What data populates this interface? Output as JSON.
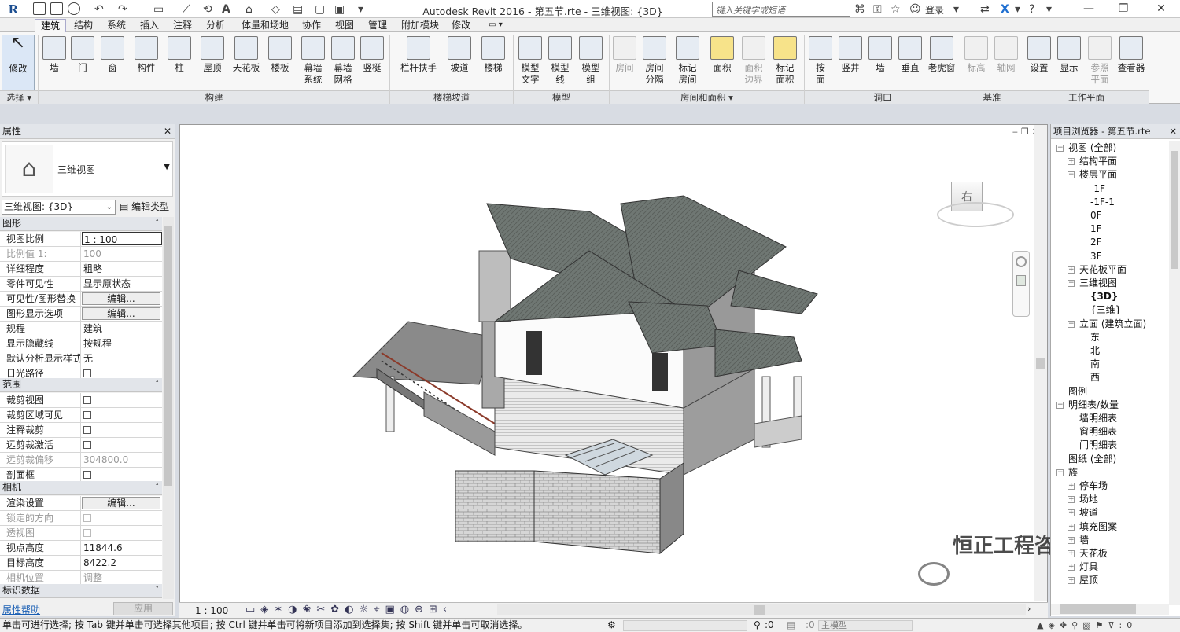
{
  "app": {
    "logo": "R",
    "title": "Autodesk Revit 2016 -    第五节.rte - 三维视图: {3D}",
    "search_placeholder": "键入关键字或短语",
    "login": "登录"
  },
  "tabs": [
    "建筑",
    "结构",
    "系统",
    "插入",
    "注释",
    "分析",
    "体量和场地",
    "协作",
    "视图",
    "管理",
    "附加模块",
    "修改"
  ],
  "ribbon": {
    "buttons": [
      {
        "label": "修改"
      },
      {
        "label": "墙"
      },
      {
        "label": "门"
      },
      {
        "label": "窗"
      },
      {
        "label": "构件"
      },
      {
        "label": "柱"
      },
      {
        "label": "屋顶"
      },
      {
        "label": "天花板"
      },
      {
        "label": "楼板"
      },
      {
        "label": "幕墙\n系统"
      },
      {
        "label": "幕墙\n网格"
      },
      {
        "label": "竖梃"
      },
      {
        "label": "栏杆扶手"
      },
      {
        "label": "坡道"
      },
      {
        "label": "楼梯"
      },
      {
        "label": "模型\n文字"
      },
      {
        "label": "模型\n线"
      },
      {
        "label": "模型\n组"
      },
      {
        "label": "房间"
      },
      {
        "label": "房间\n分隔"
      },
      {
        "label": "标记\n房间"
      },
      {
        "label": "面积"
      },
      {
        "label": "面积\n边界"
      },
      {
        "label": "标记\n面积"
      },
      {
        "label": "按\n面"
      },
      {
        "label": "竖井"
      },
      {
        "label": "墙"
      },
      {
        "label": "垂直"
      },
      {
        "label": "老虎窗"
      },
      {
        "label": "标高"
      },
      {
        "label": "轴网"
      },
      {
        "label": "设置"
      },
      {
        "label": "显示"
      },
      {
        "label": "参照\n平面"
      },
      {
        "label": "查看器"
      }
    ],
    "panels": [
      "选择",
      "构建",
      "楼梯坡道",
      "模型",
      "房间和面积",
      "洞口",
      "基准",
      "工作平面"
    ]
  },
  "properties": {
    "title": "属性",
    "type_name": "三维视图",
    "instance_selector": "三维视图: {3D}",
    "edit_type": "编辑类型",
    "sections": {
      "graphics": "图形",
      "extents": "范围",
      "camera": "相机",
      "identity": "标识数据"
    },
    "rows_graphics": [
      {
        "k": "视图比例",
        "v": "1 : 100"
      },
      {
        "k": "比例值 1:",
        "v": "100"
      },
      {
        "k": "详细程度",
        "v": "粗略"
      },
      {
        "k": "零件可见性",
        "v": "显示原状态"
      },
      {
        "k": "可见性/图形替换",
        "v": "编辑..."
      },
      {
        "k": "图形显示选项",
        "v": "编辑..."
      },
      {
        "k": "规程",
        "v": "建筑"
      },
      {
        "k": "显示隐藏线",
        "v": "按规程"
      },
      {
        "k": "默认分析显示样式",
        "v": "无"
      },
      {
        "k": "日光路径",
        "v": ""
      }
    ],
    "rows_extents": [
      {
        "k": "裁剪视图",
        "v": ""
      },
      {
        "k": "裁剪区域可见",
        "v": ""
      },
      {
        "k": "注释裁剪",
        "v": ""
      },
      {
        "k": "远剪裁激活",
        "v": ""
      },
      {
        "k": "远剪裁偏移",
        "v": "304800.0"
      },
      {
        "k": "剖面框",
        "v": ""
      }
    ],
    "rows_camera": [
      {
        "k": "渲染设置",
        "v": "编辑..."
      },
      {
        "k": "锁定的方向",
        "v": ""
      },
      {
        "k": "透视图",
        "v": ""
      },
      {
        "k": "视点高度",
        "v": "11844.6"
      },
      {
        "k": "目标高度",
        "v": "8422.2"
      },
      {
        "k": "相机位置",
        "v": "调整"
      }
    ],
    "help": "属性帮助",
    "apply": "应用"
  },
  "viewcube": {
    "face": "右"
  },
  "browser": {
    "title": "项目浏览器 - 第五节.rte",
    "nodes": [
      {
        "t": "视图 (全部)",
        "d": 0
      },
      {
        "t": "结构平面",
        "d": 1
      },
      {
        "t": "楼层平面",
        "d": 1
      },
      {
        "t": "-1F",
        "d": 2
      },
      {
        "t": "-1F-1",
        "d": 2
      },
      {
        "t": "0F",
        "d": 2
      },
      {
        "t": "1F",
        "d": 2
      },
      {
        "t": "2F",
        "d": 2
      },
      {
        "t": "3F",
        "d": 2
      },
      {
        "t": "天花板平面",
        "d": 1
      },
      {
        "t": "三维视图",
        "d": 1
      },
      {
        "t": "{3D}",
        "d": 2
      },
      {
        "t": "{三维}",
        "d": 2
      },
      {
        "t": "立面 (建筑立面)",
        "d": 1
      },
      {
        "t": "东",
        "d": 2
      },
      {
        "t": "北",
        "d": 2
      },
      {
        "t": "南",
        "d": 2
      },
      {
        "t": "西",
        "d": 2
      },
      {
        "t": "图例",
        "d": 0
      },
      {
        "t": "明细表/数量",
        "d": 0
      },
      {
        "t": "墙明细表",
        "d": 1
      },
      {
        "t": "窗明细表",
        "d": 1
      },
      {
        "t": "门明细表",
        "d": 1
      },
      {
        "t": "图纸 (全部)",
        "d": 0
      },
      {
        "t": "族",
        "d": 0
      },
      {
        "t": "停车场",
        "d": 1
      },
      {
        "t": "场地",
        "d": 1
      },
      {
        "t": "坡道",
        "d": 1
      },
      {
        "t": "填充图案",
        "d": 1
      },
      {
        "t": "墙",
        "d": 1
      },
      {
        "t": "天花板",
        "d": 1
      },
      {
        "t": "灯具",
        "d": 1
      },
      {
        "t": "屋顶",
        "d": 1
      }
    ]
  },
  "viewbar": {
    "scale": "1 : 100"
  },
  "status": {
    "message": "单击可进行选择; 按 Tab 键并单击可选择其他项目; 按 Ctrl 键并单击可将新项目添加到选择集; 按 Shift 键并单击可取消选择。",
    "zero": ":0",
    "model": "主模型"
  },
  "watermark": "恒正工程咨询"
}
